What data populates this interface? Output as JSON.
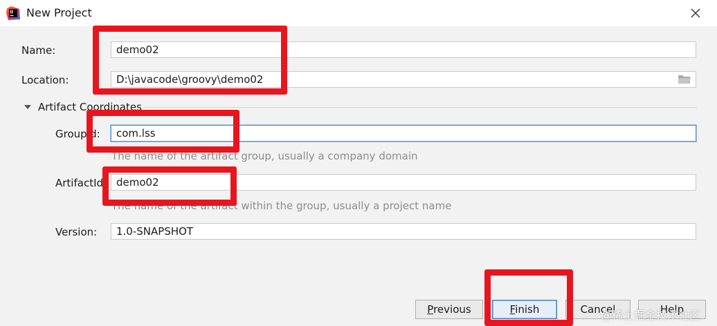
{
  "window": {
    "title": "New Project",
    "app_icon": "intellij-idea-icon",
    "close_icon": "close-icon"
  },
  "form": {
    "name_label": "Name:",
    "name_value": "demo02",
    "location_label": "Location:",
    "location_value": "D:\\javacode\\groovy\\demo02",
    "browse_icon": "folder-icon"
  },
  "artifact": {
    "section_title": "Artifact Coordinates",
    "toggle_icon": "triangle-down-icon",
    "group_label": "GroupId:",
    "group_value": "com.lss",
    "group_hint": "The name of the artifact group, usually a company domain",
    "artifact_label": "ArtifactId:",
    "artifact_value": "demo02",
    "artifact_hint": "The name of the artifact within the group, usually a project name",
    "version_label": "Version:",
    "version_value": "1.0-SNAPSHOT"
  },
  "buttons": {
    "previous_mnemonic": "P",
    "previous_rest": "revious",
    "finish_mnemonic": "F",
    "finish_rest": "inish",
    "cancel_label": "Cancel",
    "help_label": "Help"
  },
  "annotations": {
    "color": "#e8151f"
  },
  "watermark": {
    "text": "@稀土掘金技术社区"
  }
}
